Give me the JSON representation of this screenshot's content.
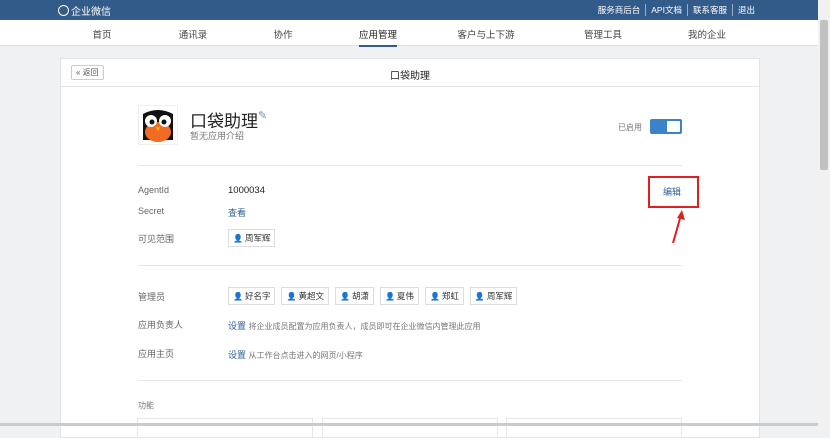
{
  "header": {
    "logo": "企业微信",
    "links": [
      "服务商后台",
      "API文档",
      "联系客服",
      "退出"
    ]
  },
  "nav": {
    "items": [
      "首页",
      "通讯录",
      "协作",
      "应用管理",
      "客户与上下游",
      "管理工具",
      "我的企业"
    ],
    "active": "应用管理"
  },
  "page": {
    "back_label": "« 返回",
    "title": "口袋助理"
  },
  "app": {
    "name": "口袋助理",
    "description": "暂无应用介绍",
    "status_label": "已启用",
    "enabled": true
  },
  "info": {
    "agentid_label": "AgentId",
    "agentid": "1000034",
    "secret_label": "Secret",
    "secret_action": "查看",
    "scope_label": "可见范围",
    "scope": [
      "周军辉"
    ],
    "edit_label": "编辑"
  },
  "admins": {
    "label": "管理员",
    "members": [
      "好名字",
      "黄超文",
      "胡潇",
      "夏伟",
      "郑虹",
      "周军辉"
    ]
  },
  "owner": {
    "label": "应用负责人",
    "action": "设置",
    "hint": "将企业成员配置为应用负责人，成员即可在企业微信内管理此应用"
  },
  "homepage": {
    "label": "应用主页",
    "action": "设置",
    "hint": "从工作台点击进入的网页/小程序"
  },
  "features": {
    "label": "功能"
  }
}
